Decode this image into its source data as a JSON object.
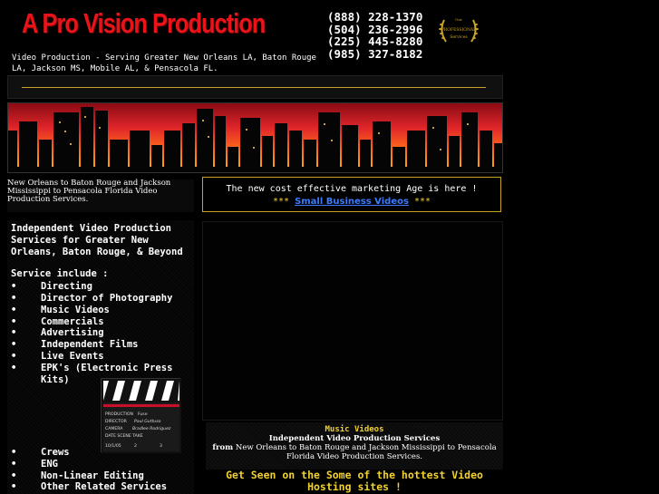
{
  "header": {
    "title": "A Pro Vision Production",
    "tagline": "Video Production - Serving Greater New Orleans LA, Baton Rouge LA, Jackson MS, Mobile AL, & Pensacola FL.",
    "phones": [
      "(888) 228-1370",
      "(504) 236-2996",
      "(225) 445-8280",
      "(985) 327-8182"
    ],
    "award_icon": "award-laurel-icon",
    "award_text": [
      "Our",
      "PROFESSIONAL",
      "Services"
    ]
  },
  "intro": {
    "text": "New Orleans to Baton Rouge and Jackson Mississippi to Pensacola Florida Video Production Services."
  },
  "marketing": {
    "line1": "The new cost effective marketing Age is here !",
    "stars_left": "***",
    "link_label": "Small Business Videos",
    "stars_right": "***"
  },
  "services": {
    "heading": "Independent Video Production Services for Greater New Orleans, Baton Rouge, & Beyond",
    "subheading": "Service include :",
    "items_primary": [
      "Directing",
      "Director of Photography",
      "Music Videos",
      "Commercials",
      "Advertising",
      "Independent Films",
      "Live Events",
      "EPK's (Electronic Press Kits)"
    ],
    "items_secondary": [
      "Crews",
      "ENG",
      "Non-Linear Editing",
      "Other Related Services"
    ]
  },
  "clapperboard": {
    "rows": [
      "PRODUCTION",
      "DIRECTOR",
      "CAMERA",
      "DATE  SCENE  TAKE"
    ],
    "values": [
      "Fuse",
      "Paul Guttuso",
      "Bradlee Rodriguez"
    ],
    "date_scene_take": [
      "10/1/05",
      "2",
      "3"
    ]
  },
  "music": {
    "title": "Music Videos",
    "subtitle": "Independent Video Production Services",
    "from_label": "from",
    "from_text": "New Orleans to Baton Rouge and Jackson Mississippi to Pensacola Florida Video Production Services.",
    "get_seen": "Get Seen on the Some of the hottest Video Hosting sites !"
  },
  "colors": {
    "title_red": "#e8141a",
    "gold": "#c9a227",
    "yellow": "#f1d22e",
    "link_blue": "#3b7cff"
  }
}
